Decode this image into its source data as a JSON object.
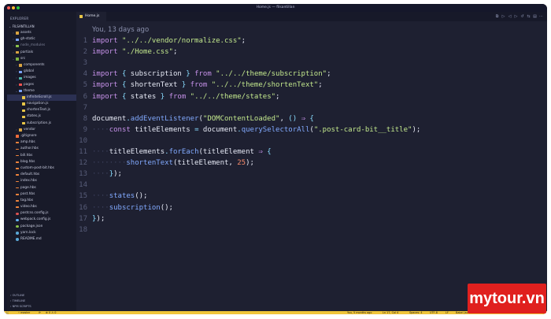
{
  "window": {
    "title": "Home.js — filsantillan"
  },
  "sidebar": {
    "title": "EXPLORER",
    "project": "FILSANTILLAN",
    "tree": [
      {
        "label": "assets",
        "depth": 1,
        "type": "folder",
        "open": false,
        "color": "#d9a441"
      },
      {
        "label": "gh-static",
        "depth": 1,
        "type": "folder",
        "open": false,
        "color": "#7aa2f7"
      },
      {
        "label": "node_modules",
        "depth": 1,
        "type": "folder",
        "open": false,
        "color": "#8bc34a"
      },
      {
        "label": "partials",
        "depth": 1,
        "type": "folder",
        "open": false,
        "color": "#d9a441"
      },
      {
        "label": "src",
        "depth": 1,
        "type": "folder",
        "open": true,
        "color": "#7cb342"
      },
      {
        "label": "components",
        "depth": 2,
        "type": "folder",
        "open": false,
        "color": "#d9a441"
      },
      {
        "label": "global",
        "depth": 2,
        "type": "folder",
        "open": false,
        "color": "#7aa2f7"
      },
      {
        "label": "images",
        "depth": 2,
        "type": "folder",
        "open": false,
        "color": "#4db6ac"
      },
      {
        "label": "pages",
        "depth": 2,
        "type": "folder",
        "open": false,
        "color": "#ef5350"
      },
      {
        "label": "theme",
        "depth": 2,
        "type": "folder",
        "open": true,
        "color": "#7aa2f7"
      },
      {
        "label": "infiniteScroll.js",
        "depth": 3,
        "type": "js",
        "color": "#e8c547",
        "active": true
      },
      {
        "label": "navigation.js",
        "depth": 3,
        "type": "js",
        "color": "#e8c547"
      },
      {
        "label": "shortenText.js",
        "depth": 3,
        "type": "js",
        "color": "#e8c547"
      },
      {
        "label": "states.js",
        "depth": 3,
        "type": "js",
        "color": "#e8c547"
      },
      {
        "label": "subscription.js",
        "depth": 3,
        "type": "js",
        "color": "#e8c547"
      },
      {
        "label": "vendor",
        "depth": 2,
        "type": "folder",
        "open": false,
        "color": "#d9a441"
      },
      {
        "label": ".gitignore",
        "depth": 1,
        "type": "file",
        "color": "#ef6c3a"
      },
      {
        "label": "amp.hbs",
        "depth": 1,
        "type": "hbs",
        "color": "#f0843c"
      },
      {
        "label": "author.hbs",
        "depth": 1,
        "type": "hbs",
        "color": "#f0843c"
      },
      {
        "label": "bill.hbs",
        "depth": 1,
        "type": "hbs",
        "color": "#f0843c"
      },
      {
        "label": "blog.hbs",
        "depth": 1,
        "type": "hbs",
        "color": "#f0843c"
      },
      {
        "label": "custom-post-bit.hbs",
        "depth": 1,
        "type": "hbs",
        "color": "#f0843c"
      },
      {
        "label": "default.hbs",
        "depth": 1,
        "type": "hbs",
        "color": "#f0843c"
      },
      {
        "label": "index.hbs",
        "depth": 1,
        "type": "hbs",
        "color": "#f0843c"
      },
      {
        "label": "page.hbs",
        "depth": 1,
        "type": "hbs",
        "color": "#f0843c"
      },
      {
        "label": "post.hbs",
        "depth": 1,
        "type": "hbs",
        "color": "#f0843c"
      },
      {
        "label": "tag.hbs",
        "depth": 1,
        "type": "hbs",
        "color": "#f0843c"
      },
      {
        "label": "video.hbs",
        "depth": 1,
        "type": "hbs",
        "color": "#f0843c"
      },
      {
        "label": "postcss.config.js",
        "depth": 1,
        "type": "cfg",
        "color": "#e05252"
      },
      {
        "label": "webpack.config.js",
        "depth": 1,
        "type": "cfg",
        "color": "#64b5f6"
      },
      {
        "label": "package.json",
        "depth": 1,
        "type": "cfg",
        "color": "#8bc34a"
      },
      {
        "label": "yarn.lock",
        "depth": 1,
        "type": "cfg",
        "color": "#5aa8d6"
      },
      {
        "label": "README.md",
        "depth": 1,
        "type": "cfg",
        "color": "#5aa8d6"
      }
    ],
    "bottom": [
      "OUTLINE",
      "TIMELINE",
      "NPM SCRIPTS"
    ]
  },
  "editor": {
    "tab_label": "Home.js",
    "blame": "You, 13 days ago",
    "lines": [
      {
        "n": "1",
        "parts": [
          [
            "kw",
            "import "
          ],
          [
            "str",
            "\"../../vendor/normalize.css\""
          ],
          [
            "pl",
            ";"
          ]
        ]
      },
      {
        "n": "2",
        "parts": [
          [
            "kw",
            "import "
          ],
          [
            "str",
            "\"./Home.css\""
          ],
          [
            "pl",
            ";"
          ]
        ]
      },
      {
        "n": "3",
        "parts": []
      },
      {
        "n": "4",
        "parts": [
          [
            "kw",
            "import "
          ],
          [
            "pu",
            "{ "
          ],
          [
            "pl",
            "subscription "
          ],
          [
            "pu",
            "} "
          ],
          [
            "kw",
            "from "
          ],
          [
            "str",
            "\"../../theme/subscription\""
          ],
          [
            "pl",
            ";"
          ]
        ]
      },
      {
        "n": "5",
        "parts": [
          [
            "kw",
            "import "
          ],
          [
            "pu",
            "{ "
          ],
          [
            "pl",
            "shortenText "
          ],
          [
            "pu",
            "} "
          ],
          [
            "kw",
            "from "
          ],
          [
            "str",
            "\"../../theme/shortenText\""
          ],
          [
            "pl",
            ";"
          ]
        ]
      },
      {
        "n": "6",
        "parts": [
          [
            "kw",
            "import "
          ],
          [
            "pu",
            "{ "
          ],
          [
            "pl",
            "states "
          ],
          [
            "pu",
            "} "
          ],
          [
            "kw",
            "from "
          ],
          [
            "str",
            "\"../../theme/states\""
          ],
          [
            "pl",
            ";"
          ]
        ]
      },
      {
        "n": "7",
        "parts": []
      },
      {
        "n": "8",
        "parts": [
          [
            "pl",
            "document"
          ],
          [
            "pu",
            "."
          ],
          [
            "fn",
            "addEventListener"
          ],
          [
            "pl",
            "("
          ],
          [
            "str",
            "\"DOMContentLoaded\""
          ],
          [
            "pl",
            ", "
          ],
          [
            "pu",
            "() "
          ],
          [
            "ar",
            "⇒ "
          ],
          [
            "pu",
            "{"
          ]
        ]
      },
      {
        "n": "9",
        "parts": [
          [
            "ws",
            "····"
          ],
          [
            "kw",
            "const "
          ],
          [
            "pl",
            "titleElements "
          ],
          [
            "pu",
            "= "
          ],
          [
            "pl",
            "document"
          ],
          [
            "pu",
            "."
          ],
          [
            "fn",
            "querySelectorAll"
          ],
          [
            "pl",
            "("
          ],
          [
            "str",
            "\".post-card-bit__title\""
          ],
          [
            "pl",
            ");"
          ]
        ]
      },
      {
        "n": "10",
        "parts": []
      },
      {
        "n": "11",
        "parts": [
          [
            "ws",
            "····"
          ],
          [
            "pl",
            "titleElements"
          ],
          [
            "pu",
            "."
          ],
          [
            "fn",
            "forEach"
          ],
          [
            "pl",
            "(titleElement "
          ],
          [
            "ar",
            "⇒ "
          ],
          [
            "pu",
            "{"
          ]
        ]
      },
      {
        "n": "12",
        "parts": [
          [
            "ws",
            "········"
          ],
          [
            "fn",
            "shortenText"
          ],
          [
            "pl",
            "(titleElement, "
          ],
          [
            "num",
            "25"
          ],
          [
            "pl",
            ");"
          ]
        ]
      },
      {
        "n": "13",
        "parts": [
          [
            "ws",
            "····"
          ],
          [
            "pu",
            "}"
          ],
          [
            "pl",
            ");"
          ]
        ]
      },
      {
        "n": "14",
        "parts": []
      },
      {
        "n": "15",
        "parts": [
          [
            "ws",
            "····"
          ],
          [
            "fn",
            "states"
          ],
          [
            "pl",
            "();"
          ]
        ]
      },
      {
        "n": "16",
        "parts": [
          [
            "ws",
            "····"
          ],
          [
            "fn",
            "subscription"
          ],
          [
            "pl",
            "();"
          ]
        ]
      },
      {
        "n": "17",
        "parts": [
          [
            "pu",
            "}"
          ],
          [
            "pl",
            ");"
          ]
        ]
      },
      {
        "n": "18",
        "parts": []
      }
    ],
    "tab_icons": [
      "split-icon",
      "run-icon",
      "back-icon",
      "forward-icon",
      "history-icon",
      "compare-icon",
      "layout-icon",
      "more-icon"
    ]
  },
  "status": {
    "branch": "master",
    "sync": "⟳",
    "problems": "⊗ 0 ⚠ 0",
    "blame": "You, 5 months ago",
    "position": "Ln 17, Col 4",
    "spaces": "Spaces: 4",
    "encoding": "UTF-8",
    "eol": "LF",
    "language": "Babel Javasc"
  },
  "brand": {
    "text": "mytour.vn"
  }
}
